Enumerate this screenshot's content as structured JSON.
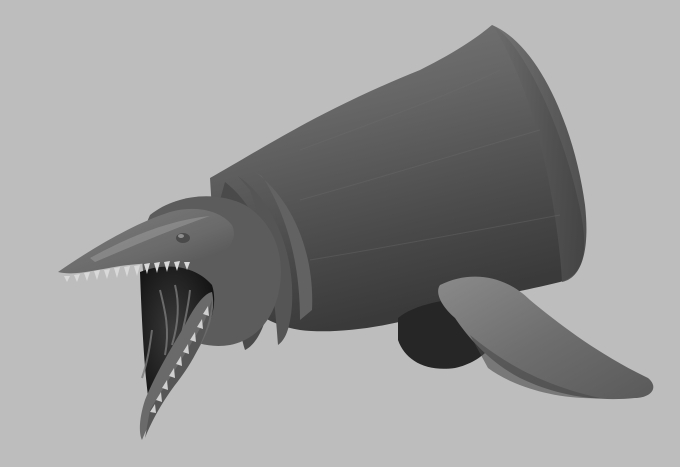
{
  "scene": {
    "subject": "sculpted-sea-creature-head",
    "background_color": "#bdbdbd",
    "body_color": "#5e5e5e",
    "highlight_color": "#8a8a8a",
    "shadow_color": "#2e2e2e",
    "mouth_color": "#1e1e1e",
    "teeth_color": "#d8d8d8"
  }
}
